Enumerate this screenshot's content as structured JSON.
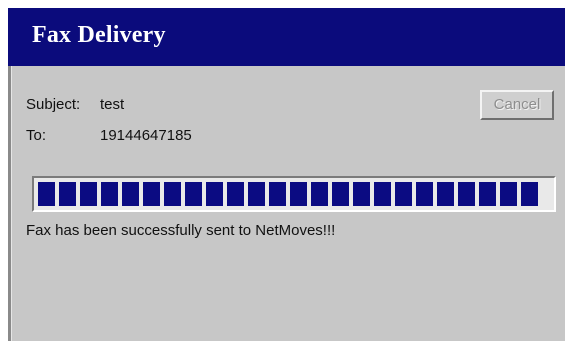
{
  "window": {
    "title": "Fax Delivery"
  },
  "fax": {
    "subject_label": "Subject:",
    "subject_value": "test",
    "to_label": "To:",
    "to_value": "19144647185"
  },
  "buttons": {
    "cancel_label": "Cancel",
    "cancel_enabled": false
  },
  "progress": {
    "percent": 100,
    "color": "#0b0b82"
  },
  "status": {
    "message": "Fax has been successfully sent to NetMoves!!!"
  },
  "colors": {
    "title_bar": "#0b0b7c",
    "dialog_bg": "#c7c7c7"
  }
}
